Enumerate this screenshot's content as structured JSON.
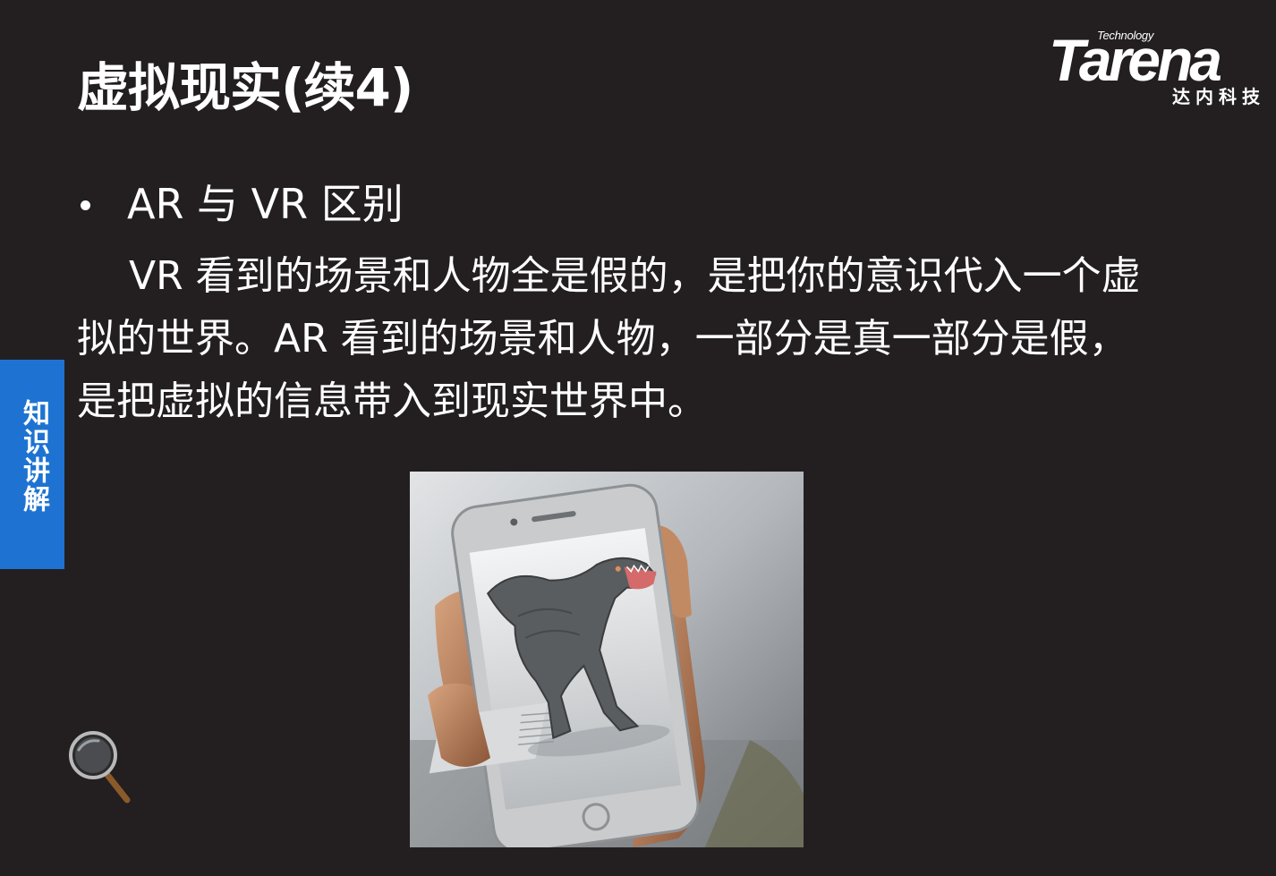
{
  "slide": {
    "title": "虚拟现实(续4)",
    "bullet": "AR 与 VR 区别",
    "paragraph_lines": [
      "VR 看到的场景和人物全是假的，是把你的意识代入一个虚",
      "拟的世界。AR 看到的场景和人物，一部分是真一部分是假，",
      "是把虚拟的信息带入到现实世界中。"
    ]
  },
  "logo": {
    "wordmark": "Tarena",
    "tagline": "Technology",
    "chinese": "达内科技"
  },
  "side_tab": {
    "label": "知识讲解"
  },
  "icons": {
    "magnifier": "magnifier-icon",
    "bullet": "bullet-icon"
  },
  "image": {
    "subject": "ar-phone-dinosaur-photo"
  },
  "colors": {
    "background": "#231f20",
    "side_tab": "#1e73d2",
    "text": "#ffffff"
  }
}
